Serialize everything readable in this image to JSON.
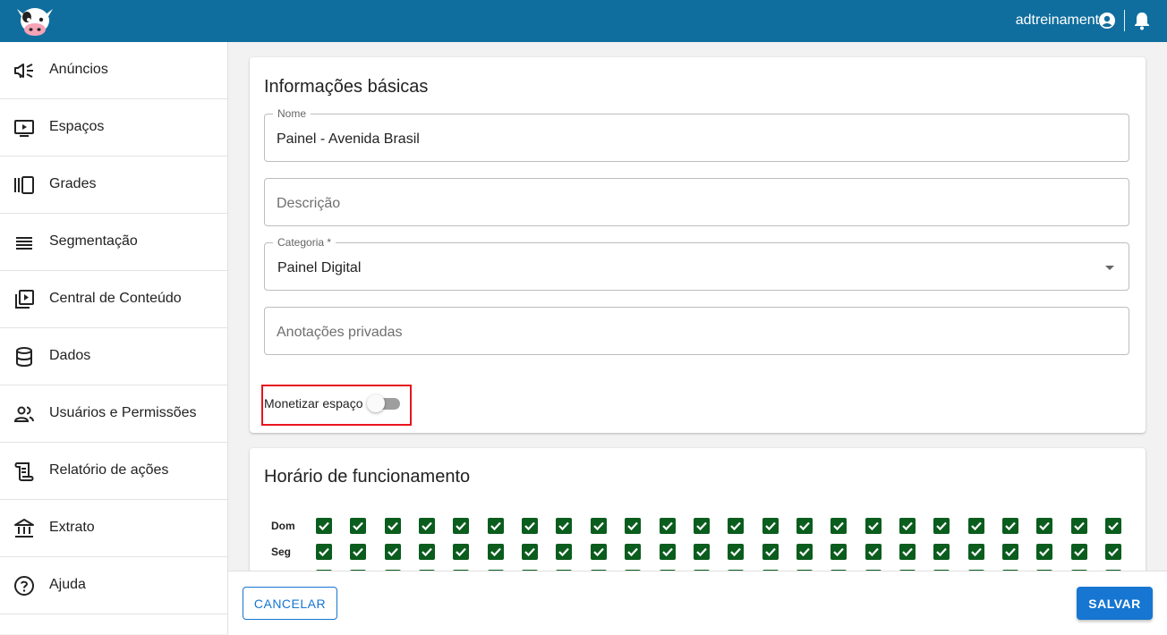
{
  "header": {
    "user_name": "adtreinamento",
    "logo_icon": "cow-logo",
    "account_icon": "account-circle-icon",
    "notification_icon": "bell-icon"
  },
  "sidebar": {
    "items": [
      {
        "label": "Anúncios",
        "icon": "megaphone-icon"
      },
      {
        "label": "Espaços",
        "icon": "screen-play-icon"
      },
      {
        "label": "Grades",
        "icon": "carousel-icon"
      },
      {
        "label": "Segmentação",
        "icon": "list-lines-icon"
      },
      {
        "label": "Central de Conteúdo",
        "icon": "video-library-icon"
      },
      {
        "label": "Dados",
        "icon": "database-icon"
      },
      {
        "label": "Usuários e Permissões",
        "icon": "people-icon"
      },
      {
        "label": "Relatório de ações",
        "icon": "scroll-report-icon"
      },
      {
        "label": "Extrato",
        "icon": "bank-icon"
      },
      {
        "label": "Ajuda",
        "icon": "help-circle-icon"
      }
    ]
  },
  "basic_info": {
    "title": "Informações básicas",
    "name": {
      "label": "Nome",
      "value": "Painel - Avenida Brasil"
    },
    "description": {
      "placeholder": "Descrição"
    },
    "category": {
      "label": "Categoria *",
      "value": "Painel Digital"
    },
    "private_notes": {
      "placeholder": "Anotações privadas"
    },
    "monetize": {
      "label": "Monetizar espaço",
      "enabled": false
    }
  },
  "schedule": {
    "title": "Horário de funcionamento",
    "rows": [
      {
        "day": "Dom",
        "hours_checked": 24
      },
      {
        "day": "Seg",
        "hours_checked": 24
      },
      {
        "day": "",
        "hours_checked": 24
      }
    ]
  },
  "footer": {
    "cancel_label": "CANCELAR",
    "save_label": "SALVAR"
  },
  "colors": {
    "header_bg": "#106e9e",
    "primary": "#1676d2",
    "checkbox_fill": "#0b5d1e",
    "highlight_box": "#e8141e"
  }
}
